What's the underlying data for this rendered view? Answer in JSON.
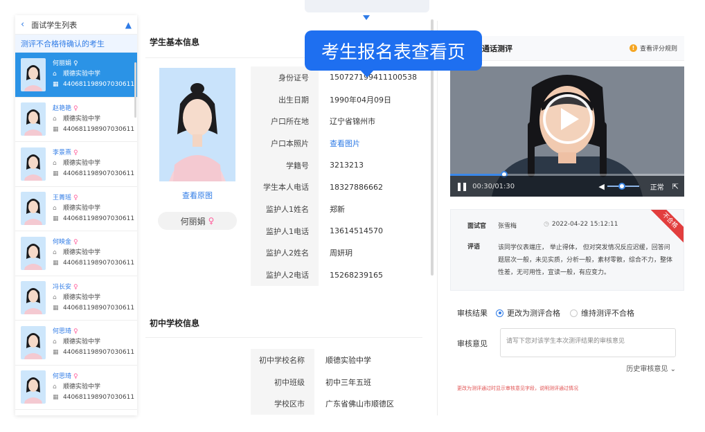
{
  "callout": {
    "text": "考生报名表查看页"
  },
  "list": {
    "title": "面试学生列表",
    "sub_header": "测评不合格待确认的考生",
    "students": [
      {
        "name": "何丽娟",
        "school": "顺德实验中学",
        "id": "440681198907030611",
        "active": true
      },
      {
        "name": "赵艳艳",
        "school": "顺德实验中学",
        "id": "440681198907030611",
        "active": false
      },
      {
        "name": "李景熹",
        "school": "顺德实验中学",
        "id": "440681198907030611",
        "active": false
      },
      {
        "name": "王菁瑶",
        "school": "顺德实验中学",
        "id": "440681198907030611",
        "active": false
      },
      {
        "name": "何映金",
        "school": "顺德实验中学",
        "id": "440681198907030611",
        "active": false
      },
      {
        "name": "冯长安",
        "school": "顺德实验中学",
        "id": "440681198907030611",
        "active": false
      },
      {
        "name": "何思琦",
        "school": "顺德实验中学",
        "id": "440681198907030611",
        "active": false
      },
      {
        "name": "何思琦",
        "school": "顺德实验中学",
        "id": "440681198907030611",
        "active": false
      }
    ]
  },
  "basic": {
    "title": "学生基本信息",
    "view_original": "查看原图",
    "name": "何丽娟",
    "fields": [
      {
        "label": "身份证号",
        "value": "150727199411100538",
        "link": false
      },
      {
        "label": "出生日期",
        "value": "1990年04月09日",
        "link": false
      },
      {
        "label": "户口所在地",
        "value": "辽宁省锦州市",
        "link": false
      },
      {
        "label": "户口本照片",
        "value": "查看图片",
        "link": true
      },
      {
        "label": "学籍号",
        "value": "3213213",
        "link": false
      },
      {
        "label": "学生本人电话",
        "value": "18327886662",
        "link": false
      },
      {
        "label": "监护人1姓名",
        "value": "郑新",
        "link": false
      },
      {
        "label": "监护人1电话",
        "value": "13614514570",
        "link": false
      },
      {
        "label": "监护人2姓名",
        "value": "周妍玥",
        "link": false
      },
      {
        "label": "监护人2电话",
        "value": "15268239165",
        "link": false
      }
    ]
  },
  "school": {
    "title": "初中学校信息",
    "fields": [
      {
        "label": "初中学校名称",
        "value": "顺德实验中学"
      },
      {
        "label": "初中班级",
        "value": "初中三年五班"
      },
      {
        "label": "学校区市",
        "value": "广东省佛山市顺德区"
      }
    ]
  },
  "test": {
    "title": "通话测评",
    "rules_link": "查看评分规则",
    "video": {
      "current": "00:30",
      "total": "01:30",
      "progress": 0.23,
      "speed": "正常"
    },
    "review": {
      "examiner_label": "面试官",
      "examiner": "张雪梅",
      "datetime": "2022-04-22  15:12:11",
      "comment_label": "评语",
      "comment": "该同学仪表端庄， 举止得体， 但对突发情况反应迟缓，回答问题层次一般，未见实质，分析一般，素材零散，综合不力，整体性差，无可用性，宣读一般，有应变力。",
      "badge": "不合格"
    },
    "audit_label": "审核结果",
    "option_pass": "更改为测评合格",
    "option_keep": "维持测评不合格",
    "opinion_label": "审核意见",
    "opinion_placeholder": "请写下您对该学生本次测评结果的审核意见",
    "history": "历史审核意见",
    "tip": "更改为测评通过时显示审核意见字段，说明测评通过情况"
  },
  "colors": {
    "accent": "#2f7be6",
    "active_row": "#2b93e6",
    "female": "#ff5f9c",
    "fail": "#e23e3e"
  }
}
